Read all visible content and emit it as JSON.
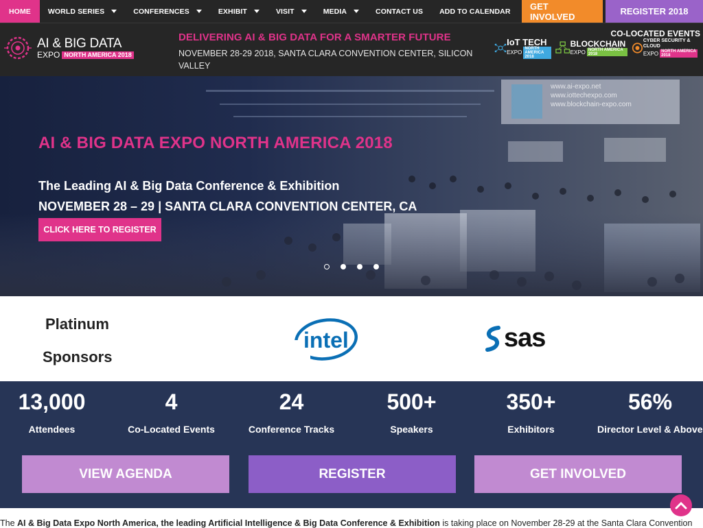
{
  "nav": {
    "home": "HOME",
    "items": [
      "WORLD SERIES",
      "CONFERENCES",
      "EXHIBIT",
      "VISIT",
      "MEDIA"
    ],
    "contact": "CONTACT US",
    "calendar": "ADD TO CALENDAR",
    "get_involved": "GET INVOLVED",
    "register": "REGISTER 2018"
  },
  "header": {
    "logo_line1": "AI & BIG DATA",
    "logo_expo": "EXPO",
    "logo_badge": "NORTH AMERICA 2018",
    "tagline": "DELIVERING AI & BIG DATA FOR A SMARTER FUTURE",
    "event_info": "NOVEMBER 28-29 2018, SANTA CLARA CONVENTION CENTER, SILICON VALLEY",
    "co_located_title": "CO-LOCATED EVENTS",
    "co_located": [
      {
        "name": "IoT TECH",
        "sub": "NORTH AMERICA 2018",
        "color": "#3fa9e0"
      },
      {
        "name": "BLOCKCHAIN",
        "sub": "NORTH AMERICA 2018",
        "color": "#7ac143"
      },
      {
        "name": "CYBER SECURITY & CLOUD",
        "sub": "NORTH AMERICA 2018",
        "color": "#e0338a"
      }
    ]
  },
  "hero": {
    "title": "AI & BIG DATA EXPO NORTH AMERICA 2018",
    "subtitle": "The Leading AI & Big Data Conference & Exhibition",
    "dates": "NOVEMBER 28 – 29  | SANTA CLARA CONVENTION CENTER, CA",
    "cta": "CLICK HERE TO REGISTER",
    "slide_count": 4,
    "active_slide": 2
  },
  "sponsors": {
    "label_line1": "Platinum",
    "label_line2": "Sponsors",
    "logos": [
      "intel",
      "sas"
    ]
  },
  "stats": [
    {
      "value": "13,000",
      "label": "Attendees"
    },
    {
      "value": "4",
      "label": "Co-Located Events"
    },
    {
      "value": "24",
      "label": "Conference Tracks"
    },
    {
      "value": "500+",
      "label": "Speakers"
    },
    {
      "value": "350+",
      "label": "Exhibitors"
    },
    {
      "value": "56%",
      "label": "Director Level & Above"
    }
  ],
  "actions": {
    "agenda": "VIEW AGENDA",
    "register": "REGISTER",
    "involved": "GET INVOLVED"
  },
  "intro": {
    "pre": "The ",
    "bold1": "AI & Big Data Expo North America",
    "mid": ", the leading Artificial Intelligence & Big Data Conference & Exhibition",
    "post": " is taking place on November 28-29 at the Santa Clara Convention"
  },
  "colors": {
    "accent": "#e0338a",
    "orange": "#f28b2a",
    "purple": "#9a63c9",
    "stats_bg": "#273556"
  }
}
